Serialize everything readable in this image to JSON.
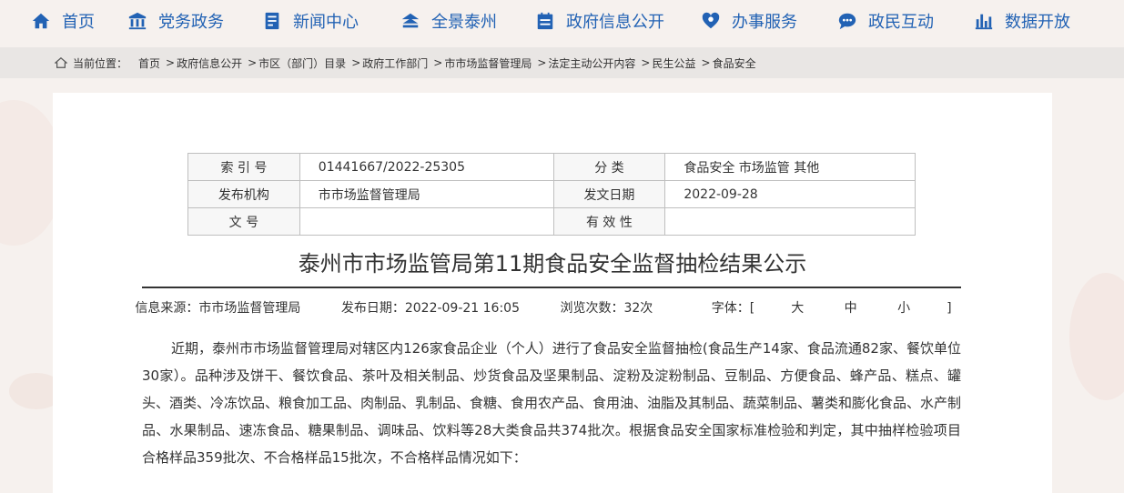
{
  "nav": [
    {
      "label": "首页",
      "icon": "home-icon"
    },
    {
      "label": "党务政务",
      "icon": "building-icon"
    },
    {
      "label": "新闻中心",
      "icon": "news-icon"
    },
    {
      "label": "全景泰州",
      "icon": "panorama-icon"
    },
    {
      "label": "政府信息公开",
      "icon": "calendar-icon"
    },
    {
      "label": "办事服务",
      "icon": "service-icon"
    },
    {
      "label": "政民互动",
      "icon": "chat-icon"
    },
    {
      "label": "数据开放",
      "icon": "bar-chart-icon"
    }
  ],
  "breadcrumb": {
    "prefix": "当前位置：",
    "items": [
      "首页",
      "政府信息公开",
      "市区（部门）目录",
      "政府工作部门",
      "市市场监督管理局",
      "法定主动公开内容",
      "民生公益",
      "食品安全"
    ]
  },
  "meta": {
    "index_label": "索 引 号",
    "index_value": "01441667/2022-25305",
    "category_label": "分    类",
    "category_value": "食品安全 市场监管 其他",
    "publisher_label": "发布机构",
    "publisher_value": "市市场监督管理局",
    "date_label": "发文日期",
    "date_value": "2022-09-28",
    "docno_label": "文    号",
    "docno_value": "",
    "validity_label": "有 效 性",
    "validity_value": ""
  },
  "article": {
    "title": "泰州市市场监管局第11期食品安全监督抽检结果公示",
    "source": "信息来源：市市场监督管理局",
    "pubdate": "发布日期：2022-09-21 16:05",
    "views": "浏览次数：32次",
    "fontsize_label": "字体：[",
    "font_large": "大",
    "font_medium": "中",
    "font_small": "小",
    "fontsize_end": "]",
    "body": "近期，泰州市市场监督管理局对辖区内126家食品企业（个人）进行了食品安全监督抽检(食品生产14家、食品流通82家、餐饮单位30家）。品种涉及饼干、餐饮食品、茶叶及相关制品、炒货食品及坚果制品、淀粉及淀粉制品、豆制品、方便食品、蜂产品、糕点、罐头、酒类、冷冻饮品、粮食加工品、肉制品、乳制品、食糖、食用农产品、食用油、油脂及其制品、蔬菜制品、薯类和膨化食品、水产制品、水果制品、速冻食品、糖果制品、调味品、饮料等28大类食品共374批次。根据食品安全国家标准检验和判定，其中抽样检验项目合格样品359批次、不合格样品15批次，不合格样品情况如下："
  },
  "colors": {
    "nav_text": "#2262b4",
    "background": "#f6f1ee",
    "crumb_bg": "#e9e6e4"
  }
}
